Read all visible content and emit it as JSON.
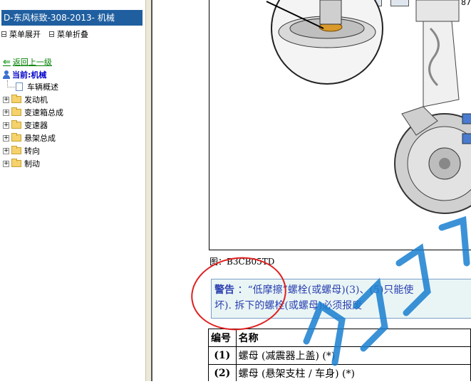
{
  "sidebar": {
    "title": "D-东风标致-308-2013- 机械",
    "expand_label": "菜单展开",
    "collapse_label": "菜单折叠",
    "back_label": "返回上一级",
    "current_label": "当前:机械",
    "items": [
      {
        "label": "车辆概述",
        "type": "doc"
      },
      {
        "label": "发动机",
        "type": "folder"
      },
      {
        "label": "变速箱总成",
        "type": "folder"
      },
      {
        "label": "变速器",
        "type": "folder"
      },
      {
        "label": "悬架总成",
        "type": "folder"
      },
      {
        "label": "转向",
        "type": "folder"
      },
      {
        "label": "制动",
        "type": "folder"
      }
    ]
  },
  "toolbar": {
    "zoom_text": "87"
  },
  "content": {
    "caption": "图：B3CB05TD",
    "warning": {
      "title": "警告",
      "line1": "：“低摩擦”螺栓(或螺母)(3)、(5)只能使",
      "line2": "坏). 拆下的螺栓(或螺母)必须报废"
    },
    "table": {
      "headers": [
        "编号",
        "名称"
      ],
      "rows": [
        {
          "num": "(1)",
          "name": "螺母 (减震器上盖) (*)"
        },
        {
          "num": "(2)",
          "name": "螺母 (悬架支柱 / 车身) (*)"
        }
      ]
    }
  },
  "colors": {
    "sidebar_title_bg": "#1f5fa0",
    "warning_text": "#2a3fb0",
    "back_link": "#008000",
    "annotation_red": "#e02020",
    "watermark_blue": "#1a7fd0"
  }
}
